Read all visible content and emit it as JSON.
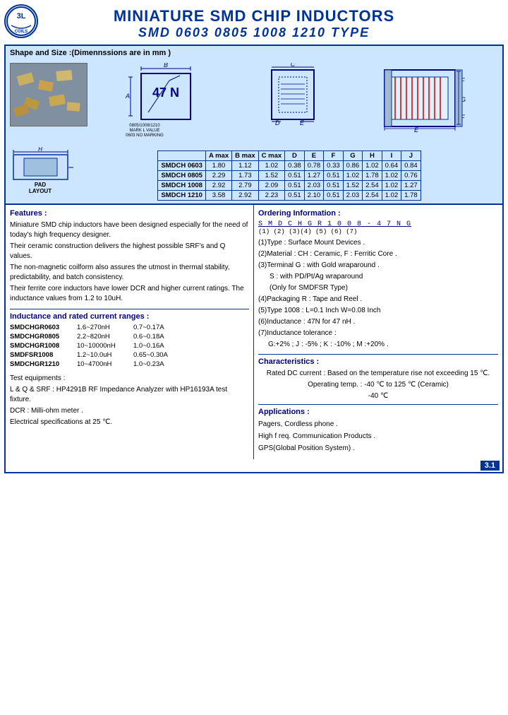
{
  "header": {
    "main_title": "MINIATURE SMD CHIP INDUCTORS",
    "sub_title": "SMD 0603     0805     1008     1210  TYPE",
    "logo_text": "3L",
    "logo_subtext": "3L COILS"
  },
  "shape_size": {
    "title": "Shape and Size :(Dimennssions are in mm )"
  },
  "dim_table": {
    "headers": [
      "",
      "A max",
      "B max",
      "C max",
      "D",
      "E",
      "F",
      "G",
      "H",
      "I",
      "J"
    ],
    "rows": [
      [
        "SMDCH 0603",
        "1.80",
        "1.12",
        "1.02",
        "0.38",
        "0.78",
        "0.33",
        "0.86",
        "1.02",
        "0.64",
        "0.84"
      ],
      [
        "SMDCH 0805",
        "2.29",
        "1.73",
        "1.52",
        "0.51",
        "1.27",
        "0.51",
        "1.02",
        "1.78",
        "1.02",
        "0.76"
      ],
      [
        "SMDCH 1008",
        "2.92",
        "2.79",
        "2.09",
        "0.51",
        "2.03",
        "0.51",
        "1.52",
        "2.54",
        "1.02",
        "1.27"
      ],
      [
        "SMDCH 1210",
        "3.58",
        "2.92",
        "2.23",
        "0.51",
        "2.10",
        "0.51",
        "2.03",
        "2.54",
        "1.02",
        "1.78"
      ]
    ]
  },
  "features": {
    "title": "Features :",
    "items": [
      "Miniature SMD chip inductors have been designed especially for the need of today's high frequency designer.",
      "Their ceramic construction delivers the highest possible SRF's and Q values.",
      "The non-magnetic coilform also assures the utmost in thermal stability, predictability, and batch consistency.",
      "Their ferrite core inductors have lower DCR and higher current ratings. The inductance values from 1.2 to 10uH."
    ]
  },
  "inductance": {
    "title": "Inductance and rated current ranges :",
    "rows": [
      {
        "part": "SMDCHGR0603",
        "range1": "1.6~270nH",
        "range2": "0.7~0.17A"
      },
      {
        "part": "SMDCHGR0805",
        "range1": "2.2~820nH",
        "range2": "0.6~0.18A"
      },
      {
        "part": "SMDCHGR1008",
        "range1": "10~10000nH",
        "range2": "1.0~0.16A"
      },
      {
        "part": "SMDFSR1008",
        "range1": "1.2~10.0uH",
        "range2": "0.65~0.30A"
      },
      {
        "part": "SMDCHGR1210",
        "range1": "10~4700nH",
        "range2": "1.0~0.23A"
      }
    ]
  },
  "test": {
    "items": [
      "Test equipments :",
      "L & Q & SRF : HP4291B RF Impedance Analyzer with HP16193A test fixture.",
      "DCR : Milli-ohm meter .",
      "Electrical specifications at 25 ℃."
    ]
  },
  "ordering": {
    "title": "Ordering Information :",
    "code_display": "S M D  C H  G  R  1 0 0 8 - 4 7 N  G",
    "positions": "(1)    (2)  (3)(4)    (5)         (6)  (7)",
    "desc": [
      "(1)Type : Surface Mount Devices .",
      "(2)Material : CH : Ceramic,  F : Ferritic Core .",
      "(3)Terminal  G : with Gold wraparound .",
      "S : with PD/Pt/Ag  wraparound",
      "(Only for SMDFSR Type)",
      "(4)Packaging  R : Tape and Reel .",
      "(5)Type 1008 : L=0.1 Inch  W=0.08 Inch",
      "(6)Inductance : 47N for 47 nH .",
      "(7)Inductance tolerance :",
      "G:+2% ; J : -5% ;  K : -10% ;  M :+20% ."
    ]
  },
  "characteristics": {
    "title": "Characteristics :",
    "items": [
      "Rated DC current : Based on the temperature rise not exceeding 15 ℃.",
      "Operating temp. : -40 ℃ to 125 ℃  (Ceramic)",
      "-40 ℃"
    ]
  },
  "applications": {
    "title": "Applications :",
    "items": [
      "Pagers, Cordless phone .",
      "High f req. Communication Products .",
      "GPS(Global Position System) ."
    ]
  },
  "page_number": "3.1"
}
